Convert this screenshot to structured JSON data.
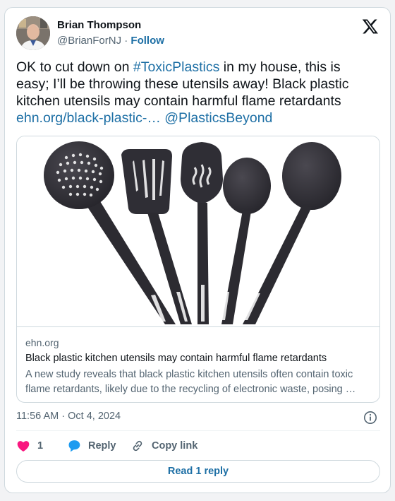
{
  "author": {
    "name": "Brian Thompson",
    "handle": "@BrianForNJ",
    "separator": "·",
    "follow_label": "Follow"
  },
  "tweet": {
    "text_1": "OK to cut down on ",
    "hashtag": "#ToxicPlastics",
    "text_2": " in my house, this is easy; I’ll be throwing these utensils away! Black plastic kitchen utensils may contain harmful flame retardants",
    "url_text": "ehn.org/black-plastic-…",
    "mention": "@PlasticsBeyond"
  },
  "link_card": {
    "domain": "ehn.org",
    "title": "Black plastic kitchen utensils may contain harmful flame retardants",
    "description": "A new study reveals that black plastic kitchen utensils often contain toxic flame retardants, likely due to the recycling of electronic waste, posing …"
  },
  "meta": {
    "time": "11:56 AM",
    "separator": "·",
    "date": "Oct 4, 2024"
  },
  "actions": {
    "like_count": "1",
    "reply_label": "Reply",
    "copy_label": "Copy link"
  },
  "read_replies_label": "Read 1 reply",
  "colors": {
    "link": "#1d6fa5",
    "heart": "#f91880",
    "reply_bubble": "#1d9bf0",
    "muted": "#536471"
  },
  "icons": [
    "x-logo-icon",
    "info-icon",
    "heart-icon",
    "reply-bubble-icon",
    "link-icon"
  ]
}
